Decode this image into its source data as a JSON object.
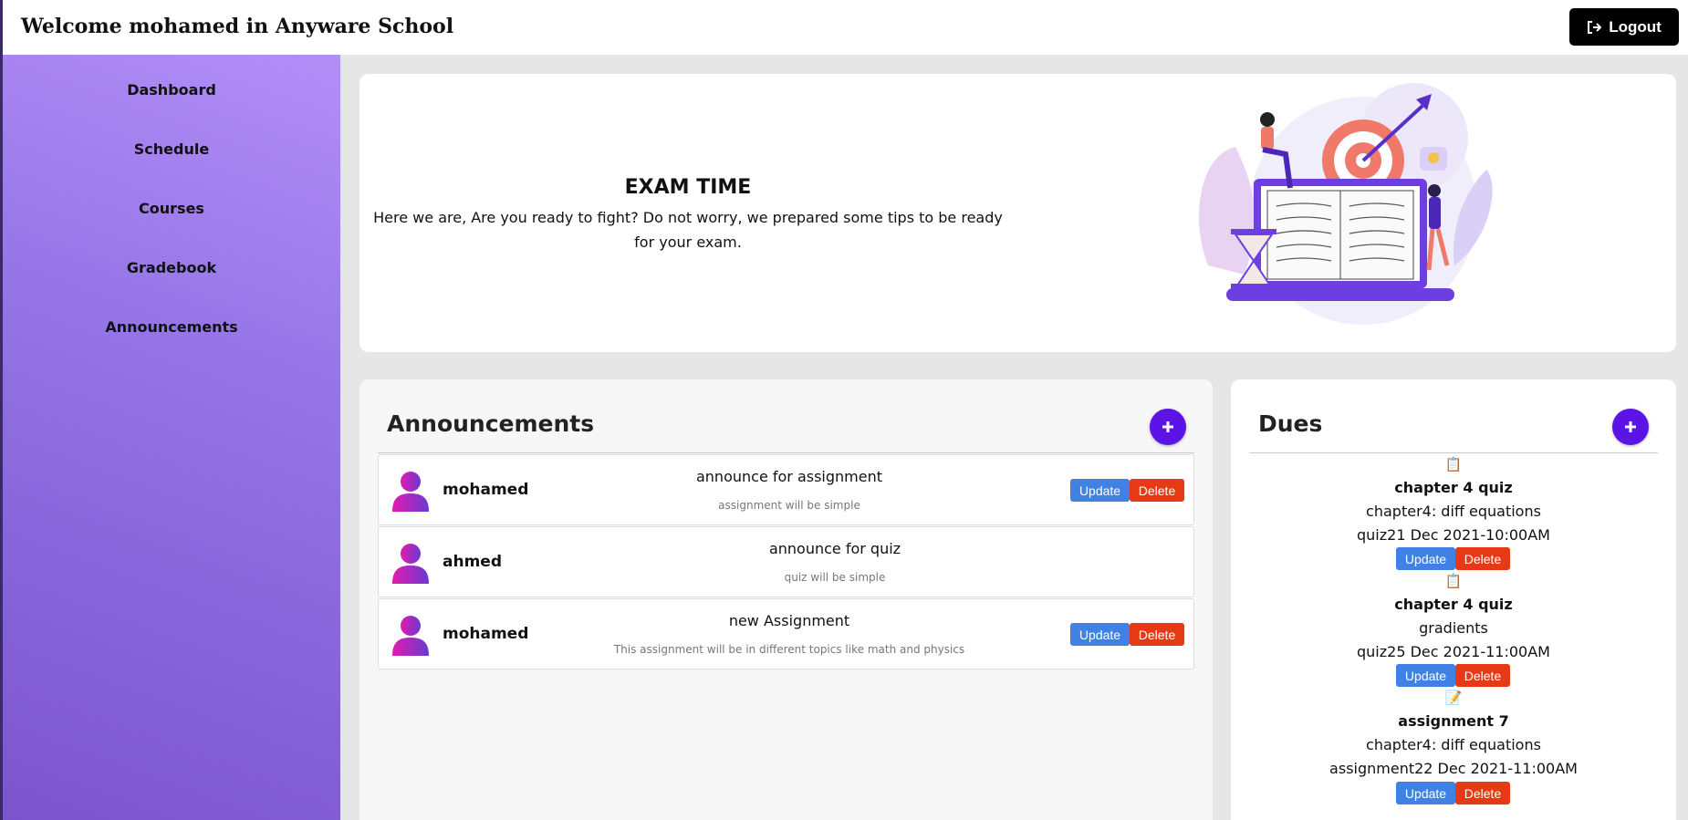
{
  "header": {
    "title": "Welcome mohamed in Anyware School",
    "logout_label": "Logout"
  },
  "sidebar": {
    "items": [
      {
        "label": "Dashboard"
      },
      {
        "label": "Schedule"
      },
      {
        "label": "Courses"
      },
      {
        "label": "Gradebook"
      },
      {
        "label": "Announcements"
      }
    ]
  },
  "hero": {
    "title": "EXAM TIME",
    "text": "Here we are, Are you ready to fight? Do not worry, we prepared some tips to be ready for your exam."
  },
  "announcements": {
    "title": "Announcements",
    "items": [
      {
        "author": "mohamed",
        "title": "announce for assignment",
        "body": "assignment will be simple",
        "update_label": "Update",
        "delete_label": "Delete"
      },
      {
        "author": "ahmed",
        "title": "announce for quiz",
        "body": "quiz will be simple"
      },
      {
        "author": "mohamed",
        "title": "new Assignment",
        "body": "This assignment will be in different topics like math and physics",
        "update_label": "Update",
        "delete_label": "Delete"
      }
    ]
  },
  "dues": {
    "title": "Dues",
    "items": [
      {
        "icon": "📋",
        "name": "chapter 4 quiz",
        "topic": "chapter4: diff equations",
        "meta": "quiz21 Dec 2021-10:00AM",
        "update_label": "Update",
        "delete_label": "Delete"
      },
      {
        "icon": "📋",
        "name": "chapter 4 quiz",
        "topic": "gradients",
        "meta": "quiz25 Dec 2021-11:00AM",
        "update_label": "Update",
        "delete_label": "Delete"
      },
      {
        "icon": "📝",
        "name": "assignment 7",
        "topic": "chapter4: diff equations",
        "meta": "assignment22 Dec 2021-11:00AM",
        "update_label": "Update",
        "delete_label": "Delete"
      }
    ]
  },
  "colors": {
    "accent": "#5b13e6",
    "update": "#3f82e4",
    "delete": "#e63a14",
    "sidebar_top": "#b28ef7",
    "sidebar_bottom": "#7b55cd"
  }
}
